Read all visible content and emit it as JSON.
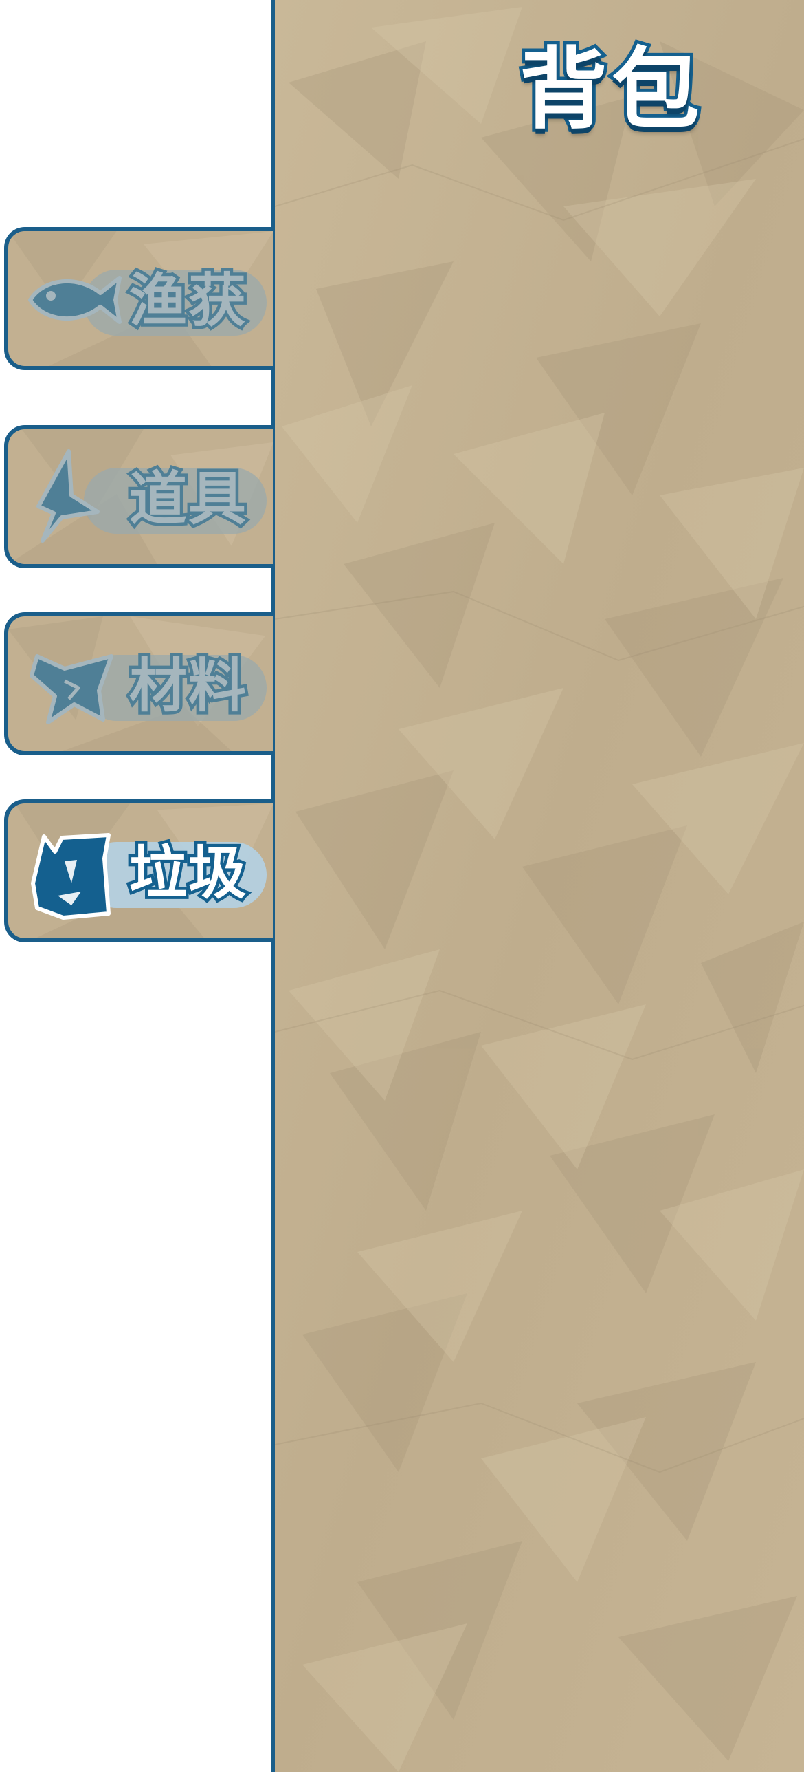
{
  "page": {
    "title": "背包"
  },
  "tabs": [
    {
      "id": "catch",
      "label": "渔获",
      "icon": "fish-icon",
      "active": false
    },
    {
      "id": "items",
      "label": "道具",
      "icon": "lightning-bolt-icon",
      "active": false
    },
    {
      "id": "materials",
      "label": "材料",
      "icon": "star-fragment-icon",
      "active": false
    },
    {
      "id": "trash",
      "label": "垃圾",
      "icon": "trash-bag-icon",
      "active": true
    }
  ],
  "colors": {
    "accent": "#1a5e8a",
    "paper": "#c4b293",
    "inactive_icon": "#4f7f96",
    "active_icon": "#14608f"
  }
}
